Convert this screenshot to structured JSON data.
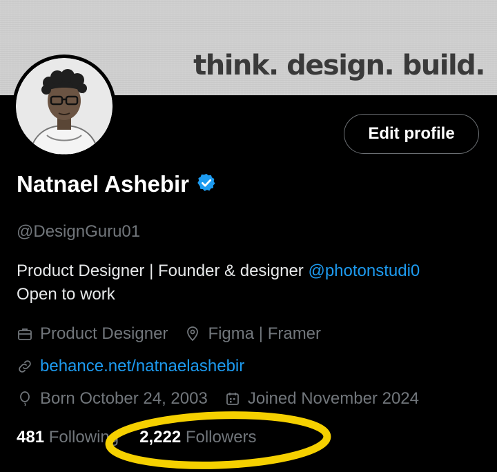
{
  "banner": {
    "text": "think. design. build."
  },
  "profile": {
    "name": "Natnael Ashebir",
    "verified": true,
    "handle": "@DesignGuru01",
    "edit_label": "Edit profile",
    "bio_line1": "Product Designer | Founder & designer ",
    "bio_mention": "@photonstudi0",
    "bio_line2": "Open to work"
  },
  "meta": {
    "profession": "Product Designer",
    "location": "Figma | Framer",
    "website": "behance.net/natnaelashebir",
    "birthday": "Born October 24, 2003",
    "joined": "Joined November 2024"
  },
  "stats": {
    "following_count": "481",
    "following_label": "Following",
    "followers_count": "2,222",
    "followers_label": "Followers"
  },
  "colors": {
    "accent": "#1d9bf0",
    "muted": "#71767b",
    "annotation": "#f5d000"
  },
  "icons": {
    "verified": "verified-badge-icon",
    "profession": "briefcase-icon",
    "location": "location-pin-icon",
    "website": "link-icon",
    "birthday": "balloon-icon",
    "joined": "calendar-icon"
  }
}
